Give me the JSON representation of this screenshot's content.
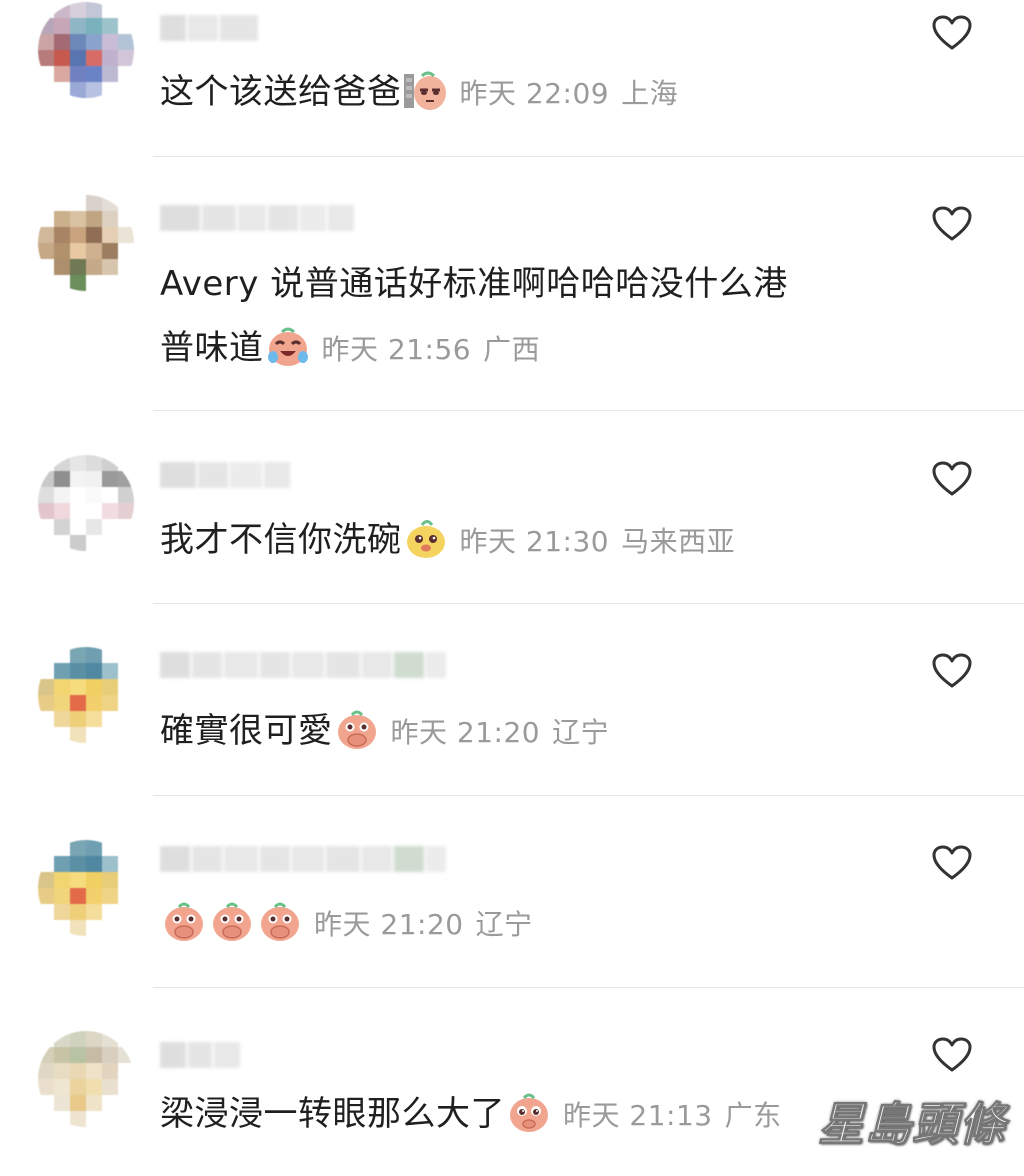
{
  "comments": [
    {
      "text": "这个该送给爸爸",
      "emoji_count": 1,
      "emoji_type": "grumpy",
      "time": "昨天 22:09",
      "location": "上海"
    },
    {
      "text": "Avery 说普通话好标准啊哈哈哈没什么港",
      "text_cont": "普味道",
      "emoji_count": 1,
      "emoji_type": "laugh-cry",
      "time": "昨天 21:56",
      "location": "广西"
    },
    {
      "text": "我才不信你洗碗",
      "emoji_count": 1,
      "emoji_type": "smug",
      "time": "昨天 21:30",
      "location": "马来西亚"
    },
    {
      "text": "確實很可愛",
      "emoji_count": 1,
      "emoji_type": "cover-mouth",
      "time": "昨天 21:20",
      "location": "辽宁"
    },
    {
      "text": "",
      "emoji_count": 3,
      "emoji_type": "cover-mouth",
      "time": "昨天 21:20",
      "location": "辽宁"
    },
    {
      "text": "梁浸浸一转眼那么大了",
      "emoji_count": 1,
      "emoji_type": "teary",
      "time": "昨天 21:13",
      "location": "广东"
    }
  ],
  "watermark": "星島頭條",
  "colors": {
    "meta_gray": "#9a9a9a",
    "divider": "#e6e6e6",
    "heart_stroke": "#333333",
    "emoji_peach": "#f2a58e"
  }
}
